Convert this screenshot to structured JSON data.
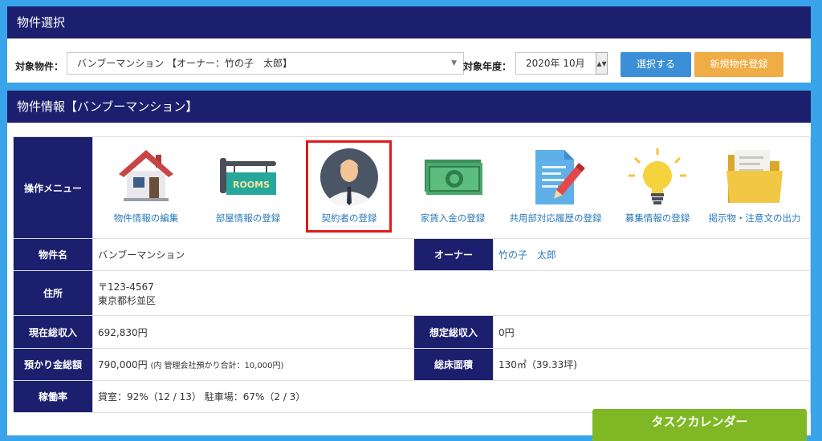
{
  "selection_panel": {
    "title": "物件選択",
    "property_label": "対象物件：",
    "property_value": "バンブーマンション 【オーナー：竹の子　太郎】",
    "year_label": "対象年度：",
    "year_value": "2020年 10月",
    "select_button": "選択する",
    "new_button": "新規物件登録"
  },
  "info_panel": {
    "title": "物件情報【バンブーマンション】",
    "menu_header": "操作メニュー",
    "menu": [
      {
        "label": "物件情報の編集",
        "icon": "house-icon"
      },
      {
        "label": "部屋情報の登録",
        "icon": "rooms-sign-icon"
      },
      {
        "label": "契約者の登録",
        "icon": "person-icon"
      },
      {
        "label": "家賃入金の登録",
        "icon": "money-icon"
      },
      {
        "label": "共用部対応履歴の登録",
        "icon": "document-pen-icon"
      },
      {
        "label": "募集情報の登録",
        "icon": "lightbulb-icon"
      },
      {
        "label": "掲示物・注意文の出力",
        "icon": "folder-icon"
      }
    ],
    "rooms_sign_text": "ROOMS",
    "rows": {
      "name_label": "物件名",
      "name_value": "バンブーマンション",
      "owner_label": "オーナー",
      "owner_value": "竹の子　太郎",
      "address_label": "住所",
      "postal": "〒123-4567",
      "address": "東京都杉並区",
      "income_label": "現在総収入",
      "income_value": "692,830円",
      "expected_label": "想定総収入",
      "expected_value": "0円",
      "deposit_label": "預かり金総額",
      "deposit_value": "790,000円",
      "deposit_note": "(内 管理会社預かり合計：10,000円)",
      "floor_label": "総床面積",
      "floor_value": "130㎡（39.33坪)",
      "occupancy_label": "稼働率",
      "occupancy_value": "貸室：92%（12 / 13） 駐車場：67%（2 / 3）"
    }
  },
  "task_calendar": "タスクカレンダー",
  "colors": {
    "background": "#3aa4ea",
    "header_navy": "#1b1f6e",
    "button_blue": "#3b8fd6",
    "button_orange": "#f0ac45",
    "link_blue": "#2a7ab8",
    "highlight_red": "#e01b1b",
    "calendar_green": "#7fb824"
  }
}
